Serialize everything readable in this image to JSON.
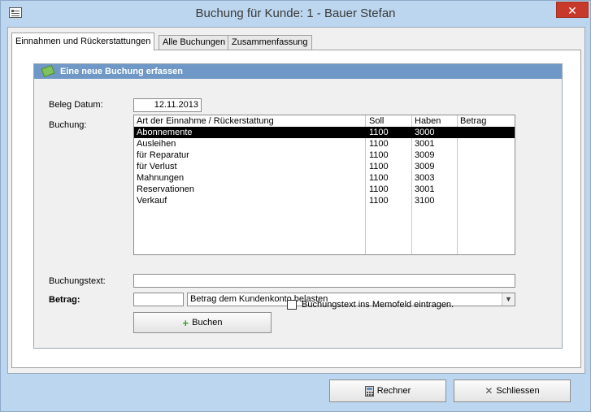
{
  "window": {
    "title": "Buchung für Kunde:  1 - Bauer Stefan",
    "close_symbol": "✕",
    "icon": "form-icon"
  },
  "tabs": [
    {
      "label": "Einnahmen und Rückerstattungen",
      "active": true
    },
    {
      "label": "Alle Buchungen",
      "active": false
    },
    {
      "label": "Zusammenfassung",
      "active": false
    }
  ],
  "section": {
    "title": "Eine neue Buchung erfassen",
    "icon": "ticket-icon",
    "header_color": "#6f98c6"
  },
  "form": {
    "beleg_datum_label": "Beleg Datum:",
    "beleg_datum_value": "12.11.2013",
    "buchung_label": "Buchung:",
    "buchungstext_label": "Buchungstext:",
    "buchungstext_value": "",
    "betrag_label": "Betrag:",
    "betrag_value": "",
    "betrag_option_selected": "Betrag dem Kundenkonto belasten",
    "buchen_label": "Buchen",
    "memo_checkbox_label": "Buchungstext ins Memofeld eintragen.",
    "memo_checked": false
  },
  "list": {
    "columns": [
      "Art der Einnahme / Rückerstattung",
      "Soll",
      "Haben",
      "Betrag"
    ],
    "rows": [
      {
        "art": "Abonnemente",
        "soll": "1100",
        "haben": "3000",
        "betrag": "",
        "selected": true
      },
      {
        "art": "Ausleihen",
        "soll": "1100",
        "haben": "3001",
        "betrag": "",
        "selected": false
      },
      {
        "art": "für Reparatur",
        "soll": "1100",
        "haben": "3009",
        "betrag": "",
        "selected": false
      },
      {
        "art": "für Verlust",
        "soll": "1100",
        "haben": "3009",
        "betrag": "",
        "selected": false
      },
      {
        "art": "Mahnungen",
        "soll": "1100",
        "haben": "3003",
        "betrag": "",
        "selected": false
      },
      {
        "art": "Reservationen",
        "soll": "1100",
        "haben": "3001",
        "betrag": "",
        "selected": false
      },
      {
        "art": "Verkauf",
        "soll": "1100",
        "haben": "3100",
        "betrag": "",
        "selected": false
      }
    ]
  },
  "footer": {
    "rechner_label": "Rechner",
    "schliessen_label": "Schliessen"
  }
}
